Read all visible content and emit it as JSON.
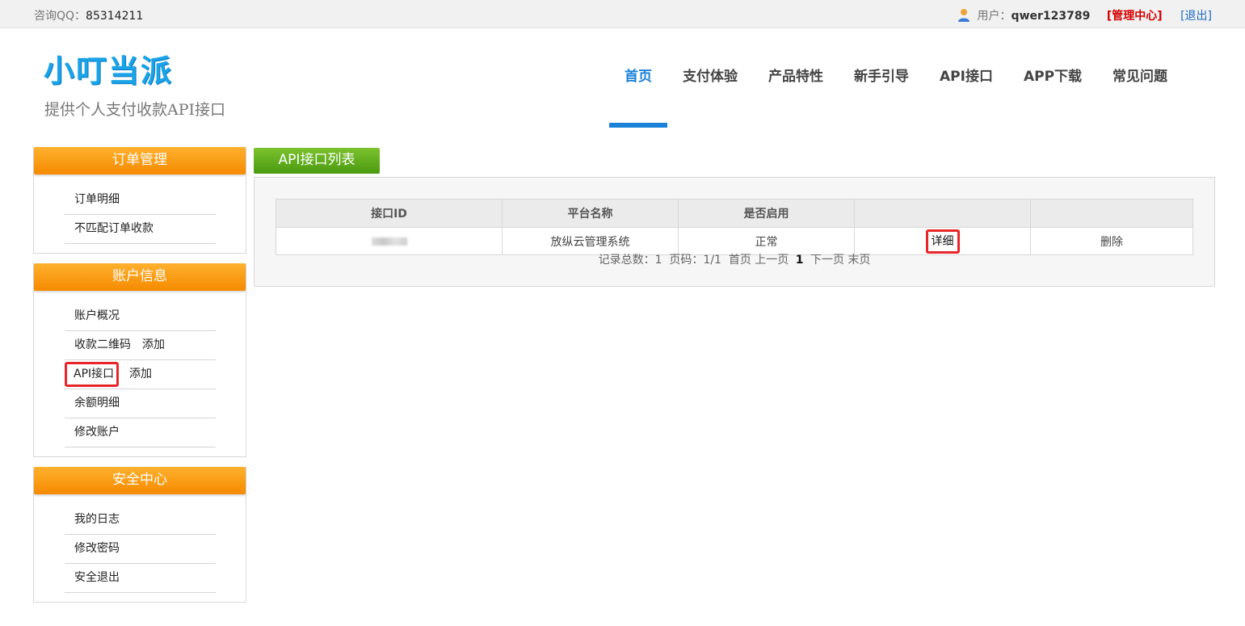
{
  "topbar": {
    "qq_label": "咨询QQ：",
    "qq_number": "85314211",
    "user_label": "用户：",
    "username": "qwer123789",
    "admin_link": "[管理中心]",
    "logout_link": "[退出]"
  },
  "header": {
    "logo_text": "小叮当派",
    "tagline": "提供个人支付收款API接口"
  },
  "nav": {
    "items": [
      {
        "label": "首页"
      },
      {
        "label": "支付体验"
      },
      {
        "label": "产品特性"
      },
      {
        "label": "新手引导"
      },
      {
        "label": "API接口"
      },
      {
        "label": "APP下载"
      },
      {
        "label": "常见问题"
      }
    ]
  },
  "sidebar": {
    "orders": {
      "title": "订单管理",
      "items": [
        "订单明细",
        "不匹配订单收款"
      ]
    },
    "account": {
      "title": "账户信息",
      "overview": "账户概况",
      "qrcode": "收款二维码",
      "qrcode_add": "添加",
      "api": "API接口",
      "api_add": "添加",
      "balance": "余额明细",
      "modify": "修改账户"
    },
    "security": {
      "title": "安全中心",
      "items": [
        "我的日志",
        "修改密码",
        "安全退出"
      ]
    }
  },
  "main": {
    "tab_title": "API接口列表",
    "columns": [
      "接口ID",
      "平台名称",
      "是否启用",
      "",
      ""
    ],
    "rows": [
      {
        "platform": "放纵云管理系统",
        "status": "正常",
        "detail": "详细",
        "delete": "删除"
      }
    ],
    "pager": {
      "total_label": "记录总数：1",
      "page_label": "页码：1/1",
      "first": "首页",
      "prev": "上一页",
      "current": "1",
      "next": "下一页",
      "last": "末页"
    }
  },
  "colors": {
    "accent_blue": "#1a82d8",
    "orange_header": "#f58a00",
    "green_tab": "#4a9a10",
    "highlight_red": "#e8262a"
  }
}
